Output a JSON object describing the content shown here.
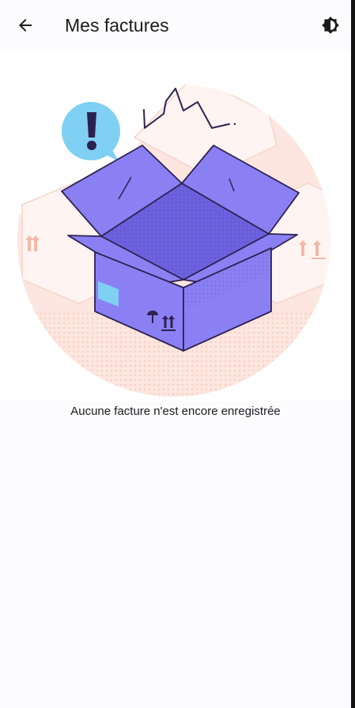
{
  "app_bar": {
    "title": "Mes factures",
    "back_icon": "arrow-back-icon",
    "theme_icon": "brightness-icon"
  },
  "empty_state": {
    "illustration": "empty-box-illustration",
    "message": "Aucune facture n'est encore enregistrée"
  },
  "colors": {
    "background": "#fcfcff",
    "box": "#8a80f4",
    "box_dark": "#6f64e6",
    "bubble": "#7fd0f2",
    "blob": "#fde6e0",
    "text": "#1b1b1f"
  }
}
